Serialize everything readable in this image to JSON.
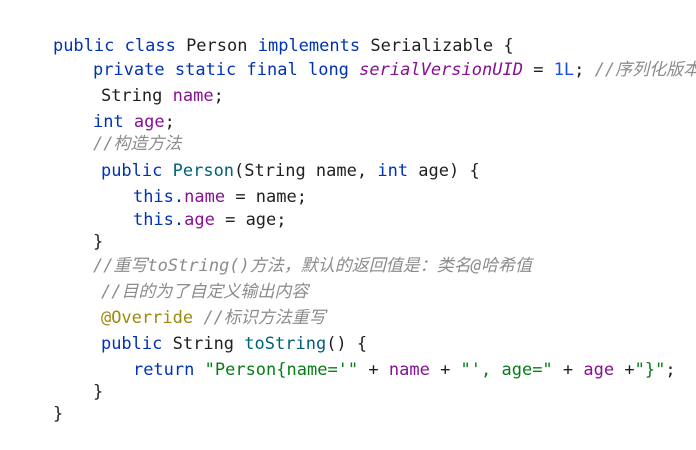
{
  "lines": [
    {
      "k1": "public",
      "k2": "class",
      "name": "Person",
      "k3": "implements",
      "iface": "Serializable",
      "brace": "{"
    },
    {
      "k1": "private",
      "k2": "static",
      "k3": "final",
      "k4": "long",
      "const": "serialVersionUID",
      "eq": "=",
      "num": "1L",
      "semi": ";",
      "comment": "//序列化版本号"
    },
    {
      "type": "String",
      "field": "name",
      "semi": ";"
    },
    {
      "type": "int",
      "field": "age",
      "semi": ";"
    },
    {
      "comment": "//构造方法"
    },
    {
      "k1": "public",
      "ctor": "Person",
      "params1": "(String name, ",
      "kw_int": "int",
      "params2": " age) {"
    },
    {
      "this": "this.",
      "field": "name",
      "rest": " = name;"
    },
    {
      "this": "this.",
      "field": "age",
      "rest": " = age;"
    },
    {
      "brace": "}"
    },
    {
      "comment": "//重写toString()方法，默认的返回值是：类名@哈希值"
    },
    {
      "comment": "//目的为了自定义输出内容"
    },
    {
      "ann": "@Override",
      "comment": "//标识方法重写"
    },
    {
      "k1": "public",
      "type": "String",
      "method": "toString",
      "rest": "() {"
    },
    {
      "ret": "return",
      "s1": "\"Person{name='\"",
      "p1": " + ",
      "f1": "name",
      "p2": " + ",
      "s2": "\"', age=\"",
      "p3": " + ",
      "f2": "age",
      "p4": " +",
      "s3": "\"}\"",
      "semi": ";"
    },
    {
      "brace": "}"
    },
    {
      "brace": "}"
    }
  ]
}
